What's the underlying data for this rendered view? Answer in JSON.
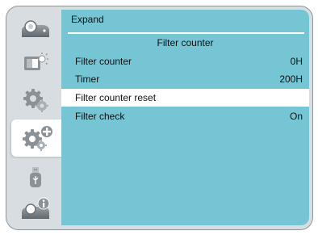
{
  "panel": {
    "title": "Expand",
    "section_title": "Filter counter"
  },
  "sidebar": {
    "items": [
      {
        "icon": "projector-icon",
        "active": false
      },
      {
        "icon": "display-brightness-icon",
        "active": false
      },
      {
        "icon": "gear-icon",
        "active": false
      },
      {
        "icon": "expand-gear-plus-icon",
        "active": true
      },
      {
        "icon": "usb-icon",
        "active": false
      },
      {
        "icon": "projector-info-icon",
        "active": false
      }
    ]
  },
  "menu": {
    "items": [
      {
        "label": "Filter counter",
        "value": "0H",
        "selected": false
      },
      {
        "label": "Timer",
        "value": "200H",
        "selected": false
      },
      {
        "label": "Filter counter reset",
        "value": "",
        "selected": true
      },
      {
        "label": "Filter check",
        "value": "On",
        "selected": false
      }
    ]
  },
  "colors": {
    "panel_bg": "#75c5d5",
    "frame_bg": "#d7dde1",
    "selected_row": "#ffffff",
    "icon_gray": "#8a9197"
  }
}
